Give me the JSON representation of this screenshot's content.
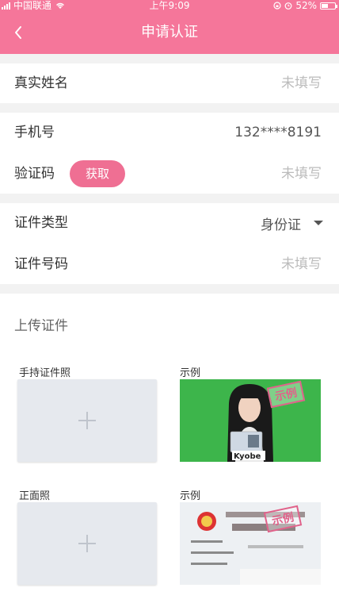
{
  "status_bar": {
    "carrier": "中国联通",
    "time": "上午9:09",
    "battery": "52%",
    "battery_level": 0.52
  },
  "header": {
    "title": "申请认证",
    "back_icon": "chevron-left-icon"
  },
  "form": {
    "real_name": {
      "label": "真实姓名",
      "placeholder": "未填写"
    },
    "phone": {
      "label": "手机号",
      "value": "132****8191"
    },
    "verification_code": {
      "label": "验证码",
      "button_label": "获取",
      "placeholder": "未填写"
    },
    "id_type": {
      "label": "证件类型",
      "value": "身份证"
    },
    "id_number": {
      "label": "证件号码",
      "placeholder": "未填写"
    }
  },
  "upload": {
    "section_title": "上传证件",
    "items": [
      {
        "label": "手持证件照",
        "example_label": "示例",
        "stamp": "示例"
      },
      {
        "label": "正面照",
        "example_label": "示例",
        "stamp": "示例"
      }
    ]
  },
  "colors": {
    "accent": "#f5769a",
    "button": "#ef6f93",
    "placeholder_text": "#bbbbbb",
    "background": "#f2f2f2"
  }
}
